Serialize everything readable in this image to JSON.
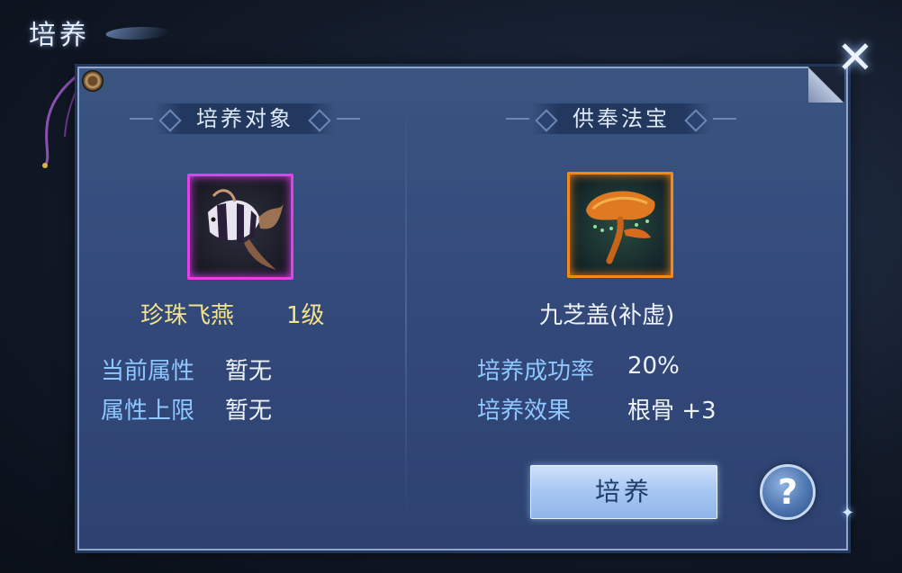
{
  "window": {
    "title": "培养",
    "close_icon": "close-x-icon"
  },
  "left": {
    "header": "培养对象",
    "item_icon": "striped-fish-icon",
    "item_name": "珍珠飞燕",
    "item_level": "1级",
    "rows": [
      {
        "key": "当前属性",
        "value": "暂无"
      },
      {
        "key": "属性上限",
        "value": "暂无"
      }
    ]
  },
  "right": {
    "header": "供奉法宝",
    "item_icon": "lingzhi-mushroom-icon",
    "item_name": "九芝盖(补虚)",
    "rows": [
      {
        "key": "培养成功率",
        "value": "20%"
      },
      {
        "key": "培养效果",
        "value": "根骨 +3"
      }
    ]
  },
  "actions": {
    "cultivate_label": "培养",
    "help_label": "?"
  },
  "colors": {
    "panel": "#33497a",
    "rarity_purple": "#e042e8",
    "rarity_orange": "#f08a1c",
    "name_gold": "#f3e38a",
    "key_blue": "#8ec6ff"
  }
}
